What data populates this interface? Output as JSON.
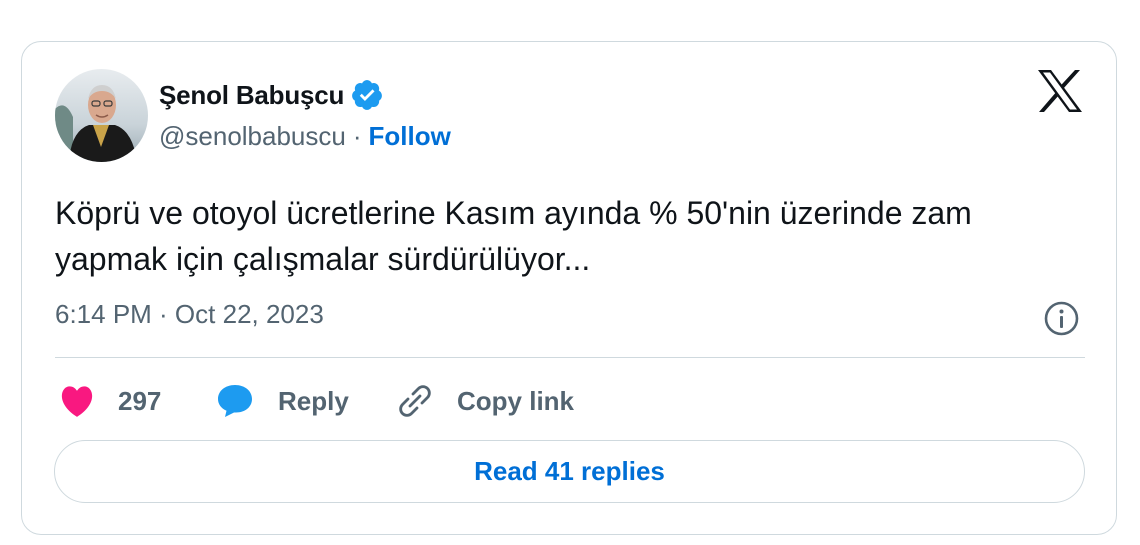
{
  "author": {
    "display_name": "Şenol Babuşcu",
    "handle": "@senolbabuscu",
    "verified": true,
    "avatar_icon": "profile-photo"
  },
  "header": {
    "separator": "·",
    "follow_label": "Follow",
    "logo_icon": "x-logo-icon"
  },
  "tweet": {
    "text": "Köprü ve otoyol ücretlerine Kasım ayında % 50'nin üzerinde zam yapmak için  çalışmalar sürdürülüyor...",
    "timestamp": "6:14 PM · Oct 22, 2023"
  },
  "actions": {
    "like_count": "297",
    "reply_label": "Reply",
    "copy_link_label": "Copy link"
  },
  "footer": {
    "read_replies_label": "Read 41 replies"
  },
  "colors": {
    "accent": "#006fd6",
    "verified_badge": "#1d9bf0",
    "like": "#f91880",
    "secondary_text": "#536471",
    "border": "#cfd9de"
  }
}
